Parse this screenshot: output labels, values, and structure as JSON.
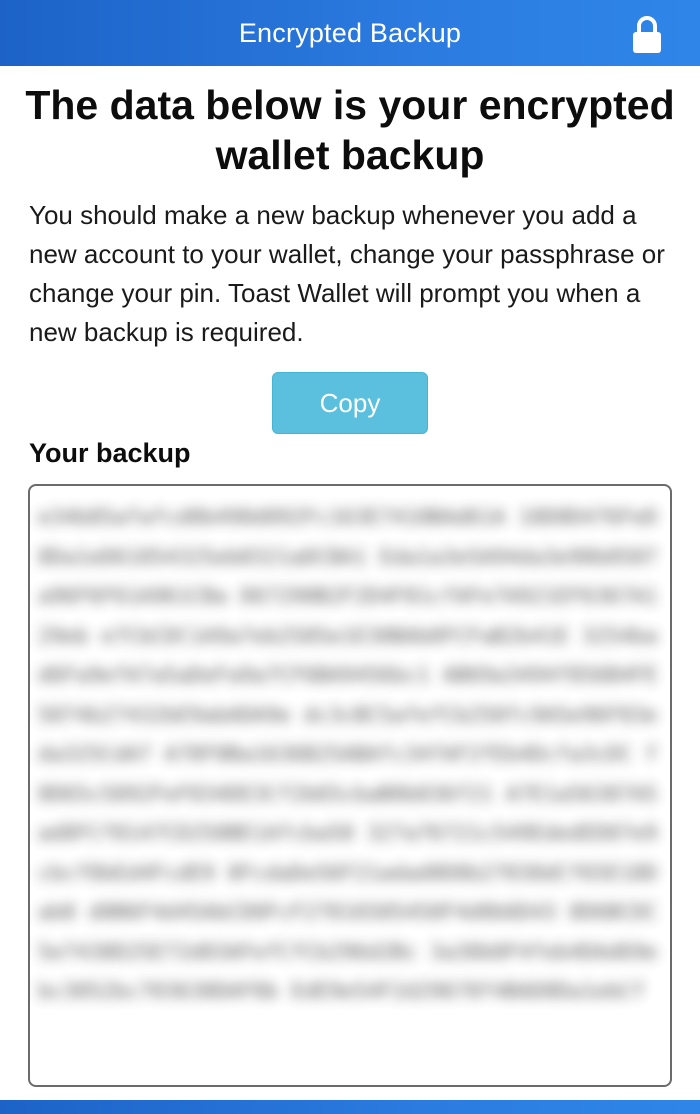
{
  "header": {
    "title": "Encrypted Backup",
    "lock_icon": "lock-icon"
  },
  "main": {
    "heading": "The data below is your encrypted wallet backup",
    "description": "You should make a new backup whenever you add a new account to your wallet, change your passphrase or change your pin. Toast Wallet will prompt you when a new backup is required.",
    "copy_label": "Copy",
    "backup_label": "Your backup"
  },
  "colors": {
    "header": "#2b7be0",
    "copy_button": "#5bc0de"
  }
}
